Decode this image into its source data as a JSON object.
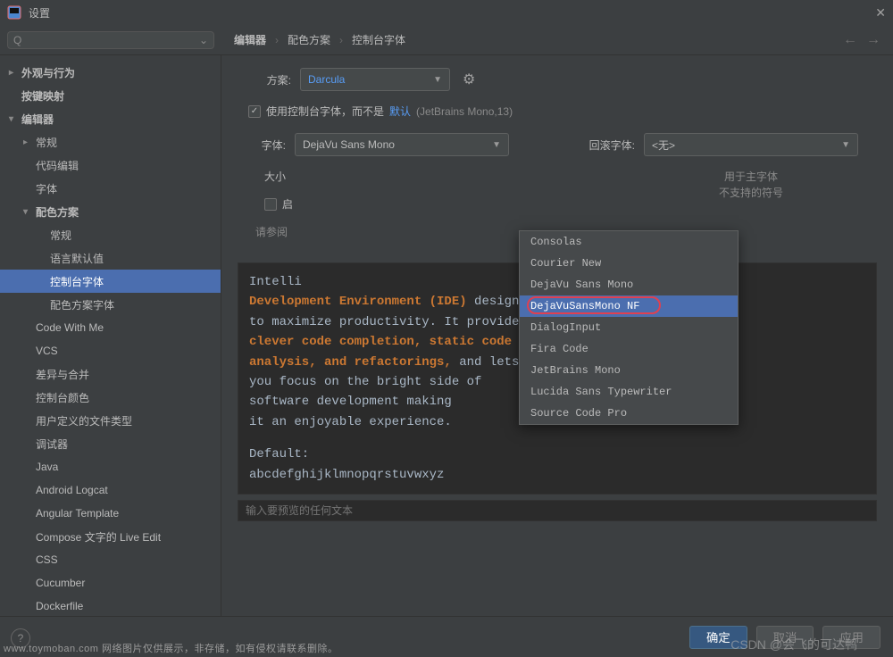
{
  "window": {
    "title": "设置"
  },
  "search": {
    "placeholder": ""
  },
  "breadcrumbs": {
    "items": [
      "编辑器",
      "配色方案",
      "控制台字体"
    ]
  },
  "sidebar": {
    "items": [
      {
        "label": "外观与行为",
        "level": 0,
        "arrow": "right",
        "bold": true
      },
      {
        "label": "按键映射",
        "level": 0,
        "bold": true
      },
      {
        "label": "编辑器",
        "level": 0,
        "arrow": "down",
        "bold": true
      },
      {
        "label": "常规",
        "level": 1,
        "arrow": "right"
      },
      {
        "label": "代码编辑",
        "level": 1
      },
      {
        "label": "字体",
        "level": 1
      },
      {
        "label": "配色方案",
        "level": 1,
        "arrow": "down",
        "bold": true
      },
      {
        "label": "常规",
        "level": 2
      },
      {
        "label": "语言默认值",
        "level": 2
      },
      {
        "label": "控制台字体",
        "level": 2,
        "selected": true
      },
      {
        "label": "配色方案字体",
        "level": 2
      },
      {
        "label": "Code With Me",
        "level": 1
      },
      {
        "label": "VCS",
        "level": 1
      },
      {
        "label": "差异与合并",
        "level": 1
      },
      {
        "label": "控制台颜色",
        "level": 1
      },
      {
        "label": "用户定义的文件类型",
        "level": 1
      },
      {
        "label": "调试器",
        "level": 1
      },
      {
        "label": "Java",
        "level": 1
      },
      {
        "label": "Android Logcat",
        "level": 1
      },
      {
        "label": "Angular Template",
        "level": 1
      },
      {
        "label": "Compose 文字的 Live Edit",
        "level": 1
      },
      {
        "label": "CSS",
        "level": 1
      },
      {
        "label": "Cucumber",
        "level": 1
      },
      {
        "label": "Dockerfile",
        "level": 1
      }
    ]
  },
  "form": {
    "scheme_label": "方案:",
    "scheme_value": "Darcula",
    "use_console_font_prefix": "使用控制台字体，而不是",
    "use_console_font_link": "默认",
    "use_console_font_suffix": "(JetBrains Mono,13)",
    "font_label": "字体:",
    "font_value": "DejaVu Sans Mono",
    "fallback_label": "回滚字体:",
    "fallback_value": "<无>",
    "fallback_hint": "用于主字体\n不支持的符号",
    "size_label": "大小",
    "enable_checkbox_partial": "启",
    "see_label_partial": "请参阅",
    "font_options": [
      "Consolas",
      "Courier New",
      "DejaVu Sans Mono",
      "DejaVuSansMono NF",
      "DialogInput",
      "Fira Code",
      "JetBrains Mono",
      "Lucida Sans Typewriter",
      "Source Code Pro"
    ],
    "font_highlight_index": 3
  },
  "preview": {
    "line1_a": "Intelli",
    "line2_b": "Development Environment (IDE)",
    "line2_a": " designed",
    "line3": "to maximize productivity. It provides",
    "line4_b": "clever code completion, static code",
    "line5_b": "analysis, and refactorings,",
    "line5_a": " and lets",
    "line6": "you focus on the bright side of",
    "line7": "software development making",
    "line8": "it an enjoyable experience.",
    "line9": "Default:",
    "line10": "abcdefghijklmnopqrstuvwxyz",
    "input_placeholder": "输入要预览的任何文本"
  },
  "footer": {
    "ok": "确定",
    "cancel_partial": "取消",
    "apply_partial": "应用"
  },
  "watermarks": {
    "bottom_left": "www.toymoban.com 网络图片仅供展示，非存储，如有侵权请联系删除。",
    "bottom_right": "CSDN @会飞的可达鸭"
  }
}
